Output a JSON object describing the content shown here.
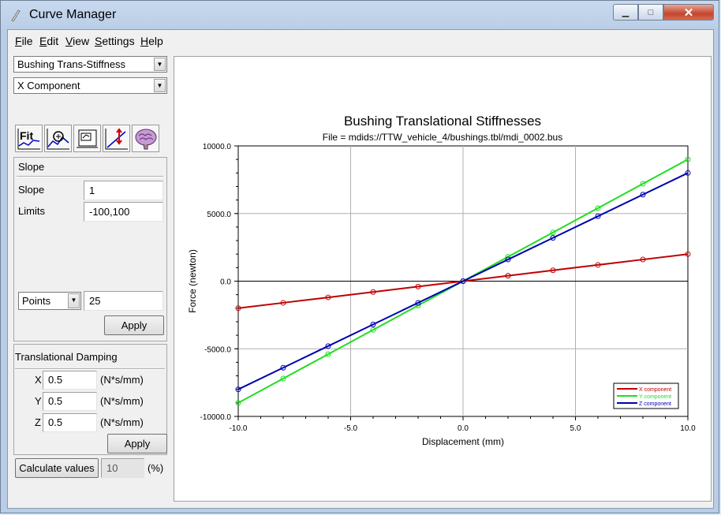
{
  "window": {
    "title": "Curve Manager",
    "minimize_glyph": "▁",
    "maximize_glyph": "□",
    "close_glyph": "✕"
  },
  "menu": [
    {
      "label": "File",
      "accel": "F",
      "rest": "ile"
    },
    {
      "label": "Edit",
      "accel": "E",
      "rest": "dit"
    },
    {
      "label": "View",
      "accel": "V",
      "rest": "iew"
    },
    {
      "label": "Settings",
      "accel": "S",
      "rest": "ettings"
    },
    {
      "label": "Help",
      "accel": "H",
      "rest": "elp"
    }
  ],
  "left": {
    "property_select": "Bushing Trans-Stiffness",
    "component_select": "X Component",
    "toolbar": [
      {
        "name": "fit-icon",
        "text": "Fit"
      },
      {
        "name": "zoom-curve-icon",
        "text": ""
      },
      {
        "name": "table-icon",
        "text": ""
      },
      {
        "name": "scale-curve-icon",
        "text": ""
      },
      {
        "name": "brain-icon",
        "text": ""
      }
    ],
    "slope_group": {
      "title": "Slope",
      "slope_label": "Slope",
      "slope_value": "1",
      "limits_label": "Limits",
      "limits_value": "-100,100",
      "points_select": "Points",
      "points_value": "25",
      "apply_label": "Apply"
    },
    "damping_group": {
      "title": "Translational Damping",
      "rows": [
        {
          "axis": "X",
          "value": "0.5",
          "unit": "(N*s/mm)"
        },
        {
          "axis": "Y",
          "value": "0.5",
          "unit": "(N*s/mm)"
        },
        {
          "axis": "Z",
          "value": "0.5",
          "unit": "(N*s/mm)"
        }
      ],
      "apply_label": "Apply"
    },
    "calculate": {
      "button_label": "Calculate values",
      "value": "10",
      "unit": "(%)"
    }
  },
  "plot": {
    "title": "Bushing Translational Stiffnesses",
    "subtitle": "File = mdids://TTW_vehicle_4/bushings.tbl/mdi_0002.bus"
  },
  "chart_data": {
    "type": "line",
    "title": "Bushing Translational Stiffnesses",
    "subtitle": "File = mdids://TTW_vehicle_4/bushings.tbl/mdi_0002.bus",
    "xlabel": "Displacement (mm)",
    "ylabel": "Force (newton)",
    "xlim": [
      -10,
      10
    ],
    "ylim": [
      -10000,
      10000
    ],
    "xticks": [
      "-10.0",
      "-5.0",
      "0.0",
      "5.0",
      "10.0"
    ],
    "yticks": [
      "-10000.0",
      "-5000.0",
      "0.0",
      "5000.0",
      "10000.0"
    ],
    "grid": true,
    "legend_position": "bottom-right",
    "x": [
      -10,
      -8,
      -6,
      -4,
      -2,
      0,
      2,
      4,
      6,
      8,
      10
    ],
    "series": [
      {
        "name": "X component",
        "color": "#c00000",
        "values": [
          -2000,
          -1600,
          -1200,
          -800,
          -400,
          0,
          400,
          800,
          1200,
          1600,
          2000
        ]
      },
      {
        "name": "Y component",
        "color": "#22dd22",
        "values": [
          -9000,
          -7200,
          -5400,
          -3600,
          -1800,
          0,
          1800,
          3600,
          5400,
          7200,
          9000
        ]
      },
      {
        "name": "Z component",
        "color": "#0000b0",
        "values": [
          -8000,
          -6400,
          -4800,
          -3200,
          -1600,
          0,
          1600,
          3200,
          4800,
          6400,
          8000
        ]
      }
    ]
  }
}
